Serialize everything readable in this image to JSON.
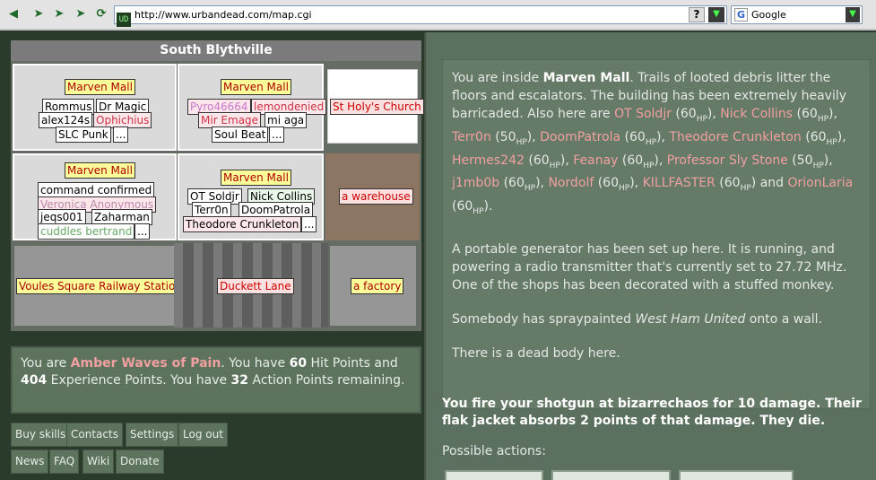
{
  "browser": {
    "url": "http://www.urbandead.com/map.cgi",
    "favicon_text": "UD",
    "search_engine": "Google",
    "help_glyph": "?"
  },
  "map": {
    "title": "South Blythville",
    "cells": [
      {
        "building": "Marven Mall",
        "survivors": [
          "Rommus",
          "Dr Magic",
          "alex124s",
          "Ophichius",
          "SLC Punk"
        ],
        "more": "..."
      },
      {
        "building": "Marven Mall",
        "survivors": [
          "Pyro46664",
          "lemondenied",
          "Mir Emage",
          "mi aga",
          "Soul Beat"
        ],
        "more": "..."
      },
      {
        "building": "St Holy's Church"
      },
      {
        "building": "Marven Mall",
        "survivors": [
          "command confirmed",
          "Veronica Anonymous",
          "jeqs001",
          "Zaharman",
          "cuddles bertrand"
        ],
        "more": "..."
      },
      {
        "building": "Marven Mall",
        "survivors": [
          "OT Soldjr",
          "Nick Collins",
          "Terr0n",
          "DoomPatrola",
          "Theodore Crunkleton"
        ],
        "more": "..."
      },
      {
        "building": "a warehouse"
      },
      {
        "building": "Voules Square Railway Station"
      },
      {
        "building": "Duckett Lane"
      },
      {
        "building": "a factory"
      }
    ]
  },
  "stats": {
    "t1": "You are ",
    "name": "Amber Waves of Pain",
    "t2": ". You have ",
    "hp": "60",
    "t3": " Hit Points and ",
    "xp": "404",
    "t4": " Experience Points. You have ",
    "ap": "32",
    "t5": " Action Points remaining."
  },
  "links": {
    "buy_skills": "Buy skills",
    "contacts": "Contacts",
    "settings": "Settings",
    "logout": "Log out",
    "news": "News",
    "faq": "FAQ",
    "wiki": "Wiki",
    "donate": "Donate"
  },
  "desc": {
    "p1a": "You are inside ",
    "location": "Marven Mall",
    "p1b": ". Trails of looted debris litter the floors and escalators. The building has been extremely heavily barricaded. Also here are ",
    "hp_unit": "HP",
    "people": [
      {
        "name": "OT Soldjr",
        "hp": "60"
      },
      {
        "name": "Nick Collins",
        "hp": "60"
      },
      {
        "name": "Terr0n",
        "hp": "50"
      },
      {
        "name": "DoomPatrola",
        "hp": "60"
      },
      {
        "name": "Theodore Crunkleton",
        "hp": "60"
      },
      {
        "name": "Hermes242",
        "hp": "60"
      },
      {
        "name": "Feanay",
        "hp": "60"
      },
      {
        "name": "Professor Sly Stone",
        "hp": "50"
      },
      {
        "name": "j1mb0b",
        "hp": "60"
      },
      {
        "name": "Nordolf",
        "hp": "60"
      },
      {
        "name": "KILLFASTER",
        "hp": "60"
      },
      {
        "name": "OrionLaria",
        "hp": "60"
      }
    ],
    "and_word": " and ",
    "p2": "A portable generator has been set up here. It is running, and powering a radio transmitter that's currently set to 27.72 MHz. One of the shops has been decorated with a stuffed monkey.",
    "p3a": "Somebody has spraypainted ",
    "graffiti": "West Ham United",
    "p3b": " onto a wall.",
    "p4": "There is a dead body here."
  },
  "shot_message": "You fire your shotgun at bizarrechaos for 10 damage. Their flak jacket absorbs 2 points of that damage. They die.",
  "possible_actions_label": "Possible actions:",
  "colors": {
    "background": "#2b3b2b",
    "panel": "#5d735d",
    "player_name": "#f0a0a0"
  }
}
